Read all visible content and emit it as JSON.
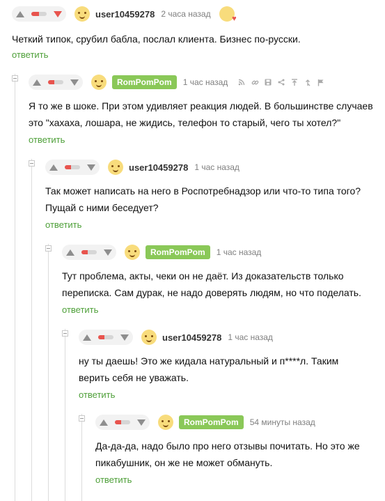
{
  "comments": [
    {
      "author": "user10459278",
      "time": "2 часа назад",
      "text_lines": [
        "Четкий типок, срубил бабла, послал клиента. Бизнес по-русски."
      ],
      "reply_label": "ответить",
      "rating_fill": 0.5
    },
    {
      "author": "RomPomPom",
      "author_is_op": true,
      "time": "1 час назад",
      "text_lines": [
        "Я то же в шоке. При этом удивляет реакция людей. В большинстве случаев",
        "это \"хахаха, лошара, не жидись, телефон то старый, чего ты хотел?\""
      ],
      "reply_label": "ответить",
      "rating_fill": 0.4
    },
    {
      "author": "user10459278",
      "time": "1 час назад",
      "text_lines": [
        "Так может написать на него в Роспотребнадзор или что-то типа того?",
        "Пущай с ними беседует?"
      ],
      "reply_label": "ответить",
      "rating_fill": 0.4
    },
    {
      "author": "RomPomPom",
      "author_is_op": true,
      "time": "1 час назад",
      "text_lines": [
        "Тут проблема, акты, чеки он не даёт. Из доказательств только",
        "переписка. Сам дурак, не надо доверять людям, но что поделать."
      ],
      "reply_label": "ответить",
      "rating_fill": 0.4
    },
    {
      "author": "user10459278",
      "time": "1 час назад",
      "text_lines": [
        "ну ты даешь! Это же кидала натуральный и п****л. Таким",
        "верить себя не уважать."
      ],
      "reply_label": "ответить",
      "rating_fill": 0.4
    },
    {
      "author": "RomPomPom",
      "author_is_op": true,
      "time": "54 минуты назад",
      "text_lines": [
        "Да-да-да, надо было про него отзывы почитать. Но это же",
        "пикабушник, он же не может обмануть."
      ],
      "reply_label": "ответить",
      "rating_fill": 0.4
    }
  ],
  "toolbar_icons": [
    "rss-icon",
    "link-icon",
    "save-icon",
    "share-icon",
    "scroll-to-parent-icon",
    "scroll-to-root-icon",
    "report-flag-icon"
  ],
  "colors": {
    "accent_green": "#4fa03a",
    "op_badge": "#8ac858",
    "downvote_active": "#e8544e"
  }
}
